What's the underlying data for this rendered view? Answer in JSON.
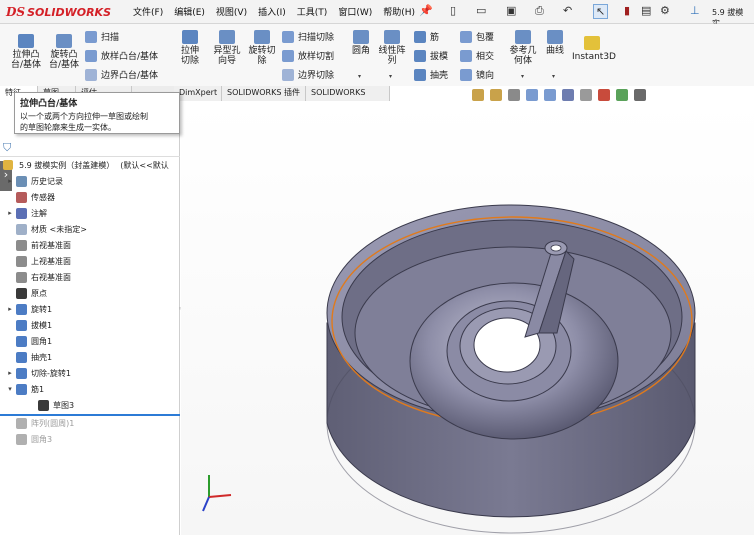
{
  "app": {
    "logo_prefix": "DS",
    "logo_text": "SOLIDWORKS",
    "doc_title": "5.9 拔模实...",
    "menus": [
      "文件(F)",
      "编辑(E)",
      "视图(V)",
      "插入(I)",
      "工具(T)",
      "窗口(W)",
      "帮助(H)"
    ]
  },
  "ribbon": {
    "extrude_boss": "拉伸凸台/基体",
    "revolve_boss": "旋转凸台/基体",
    "sweep": "扫描",
    "loft_boss": "放样凸台/基体",
    "boundary_boss": "边界凸台/基体",
    "extrude_cut": "拉伸切除",
    "hole_wizard": "异型孔向导",
    "revolve_cut": "旋转切除",
    "swept_cut": "扫描切除",
    "lofted_cut": "放样切割",
    "boundary_cut": "边界切除",
    "fillet": "圆角",
    "linear_pattern": "线性阵列",
    "rib": "筋",
    "draft": "拔模",
    "shell": "抽壳",
    "wrap": "包覆",
    "intersect": "相交",
    "mirror": "镜向",
    "reference_geometry": "参考几何体",
    "curves": "曲线",
    "instant3d": "Instant3D"
  },
  "tabs": [
    "特征",
    "草图",
    "评估",
    "DimXpert",
    "SOLIDWORKS 插件",
    "SOLIDWORKS MBD"
  ],
  "tooltip": {
    "title": "拉伸凸台/基体",
    "line1": "以一个或两个方向拉伸一草图或绘制",
    "line2": "的草图轮廓来生成一实体。"
  },
  "tree": {
    "part_name": "5.9 拔模实例（封盖建模）",
    "part_config": "(默认<<默认",
    "items": [
      {
        "label": "历史记录",
        "icon": "history-icon",
        "expander": "▸",
        "color": "#6b8fb5"
      },
      {
        "label": "传感器",
        "icon": "sensor-icon",
        "expander": "",
        "color": "#b55b5b"
      },
      {
        "label": "注解",
        "icon": "annotation-icon",
        "expander": "▸",
        "color": "#5b6fb5"
      },
      {
        "label": "材质 <未指定>",
        "icon": "material-icon",
        "expander": "",
        "color": "#9fb0c8"
      },
      {
        "label": "前视基准面",
        "icon": "plane-icon",
        "expander": "",
        "color": "#8c8c8c"
      },
      {
        "label": "上视基准面",
        "icon": "plane-icon",
        "expander": "",
        "color": "#8c8c8c"
      },
      {
        "label": "右视基准面",
        "icon": "plane-icon",
        "expander": "",
        "color": "#8c8c8c"
      },
      {
        "label": "原点",
        "icon": "origin-icon",
        "expander": "",
        "color": "#3a3a3a"
      },
      {
        "label": "旋转1",
        "icon": "revolve-feature-icon",
        "expander": "▸",
        "color": "#4c7cc4"
      },
      {
        "label": "拔模1",
        "icon": "draft-feature-icon",
        "expander": "",
        "color": "#4c7cc4"
      },
      {
        "label": "圆角1",
        "icon": "fillet-feature-icon",
        "expander": "",
        "color": "#4c7cc4"
      },
      {
        "label": "抽壳1",
        "icon": "shell-feature-icon",
        "expander": "",
        "color": "#4c7cc4"
      },
      {
        "label": "切除-旋转1",
        "icon": "cut-revolve-icon",
        "expander": "▸",
        "color": "#4c7cc4"
      },
      {
        "label": "筋1",
        "icon": "rib-feature-icon",
        "expander": "▾",
        "color": "#4c7cc4"
      },
      {
        "label": "草图3",
        "icon": "sketch-icon",
        "expander": "",
        "color": "#3a3a3a"
      },
      {
        "label": "阵列(圆周)1",
        "icon": "circular-pattern-icon",
        "expander": "",
        "color": "#b0b0b0"
      },
      {
        "label": "圆角3",
        "icon": "fillet-feature-icon",
        "expander": "",
        "color": "#b0b0b0"
      }
    ]
  },
  "colors": {
    "model_top": "#8e8ea6",
    "model_side": "#6f6f86",
    "edge_highlight": "#e07a1c"
  }
}
